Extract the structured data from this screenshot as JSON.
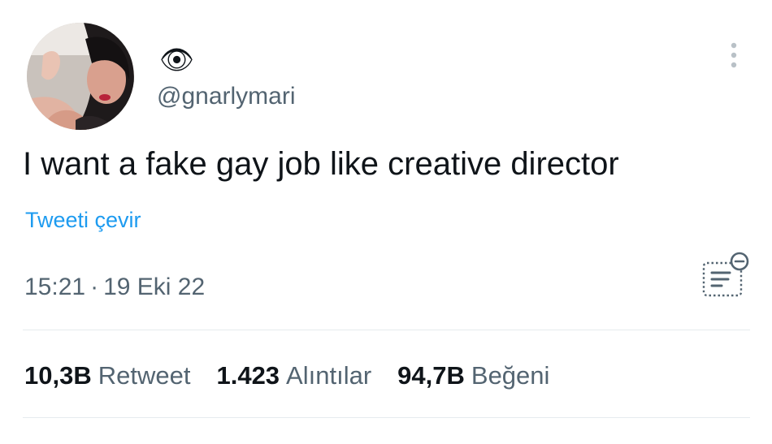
{
  "author": {
    "display_name_icon": "eye-icon",
    "display_name_glyph": "👁",
    "handle": "@gnarlymari"
  },
  "tweet": {
    "text": "I want a fake gay job like creative director",
    "translate_label": "Tweeti çevir",
    "time": "15:21",
    "separator": "·",
    "date": "19 Eki 22"
  },
  "stats": [
    {
      "count": "10,3B",
      "label": "Retweet"
    },
    {
      "count": "1.423",
      "label": "Alıntılar"
    },
    {
      "count": "94,7B",
      "label": "Beğeni"
    }
  ],
  "colors": {
    "text": "#0f1419",
    "secondary": "#536471",
    "link": "#1d9bf0",
    "divider": "#e6ebee"
  }
}
